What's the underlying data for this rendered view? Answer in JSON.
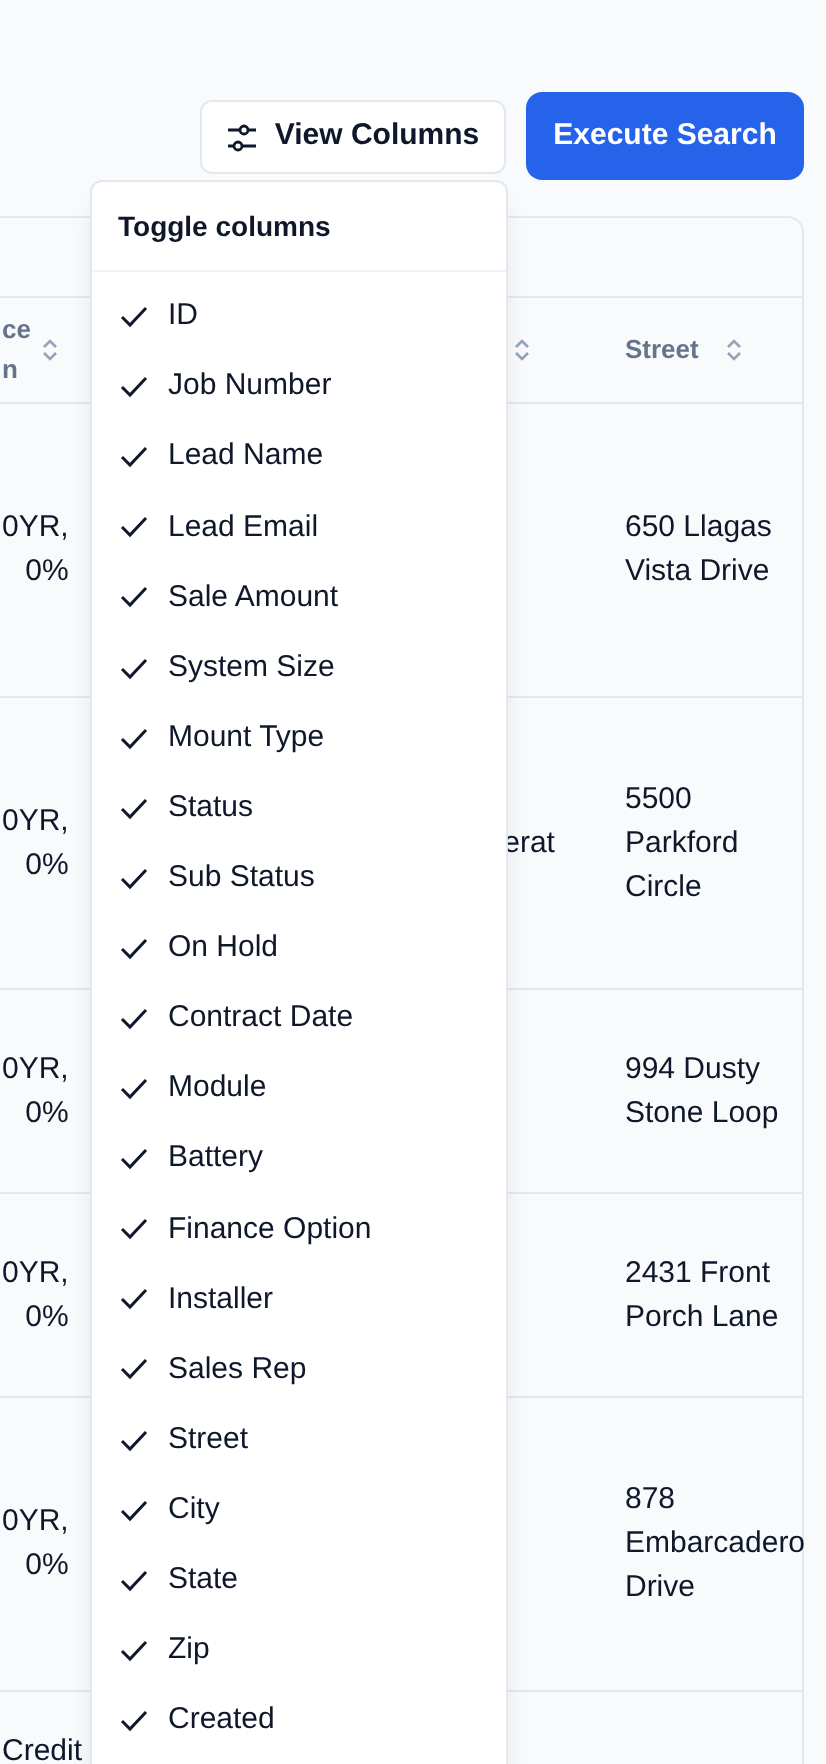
{
  "toolbar": {
    "view_columns": "View Columns",
    "execute": "Execute Search"
  },
  "table": {
    "columns": [
      {
        "label": "ce n",
        "sortable": true
      },
      {
        "sortable": true
      },
      {
        "label": "Street",
        "sortable": true
      }
    ],
    "rows": [
      {
        "cells": [
          [
            "0YR,",
            "0%"
          ],
          [],
          [
            "650 Llagas Vista Drive"
          ]
        ]
      },
      {
        "cells": [
          [
            "0YR,",
            "0%"
          ],
          [
            "erat"
          ],
          [
            "5500 Parkford Circle"
          ]
        ]
      },
      {
        "cells": [
          [
            "0YR,",
            "0%"
          ],
          [],
          [
            "994 Dusty Stone Loop"
          ]
        ]
      },
      {
        "cells": [
          [
            "0YR,",
            "0%"
          ],
          [],
          [
            "2431 Front Porch Lane"
          ]
        ]
      },
      {
        "cells": [
          [
            "0YR,",
            "0%"
          ],
          [],
          [
            "878 Embarcadero Drive"
          ]
        ]
      },
      {
        "cells": [
          [
            "Credit"
          ],
          [],
          []
        ]
      }
    ]
  },
  "column_menu": {
    "title": "Toggle columns",
    "items": [
      {
        "label": "ID",
        "checked": true
      },
      {
        "label": "Job Number",
        "checked": true
      },
      {
        "label": "Lead Name",
        "checked": true
      },
      {
        "label": "Lead Email",
        "checked": true
      },
      {
        "label": "Sale Amount",
        "checked": true
      },
      {
        "label": "System Size",
        "checked": true
      },
      {
        "label": "Mount Type",
        "checked": true
      },
      {
        "label": "Status",
        "checked": true
      },
      {
        "label": "Sub Status",
        "checked": true
      },
      {
        "label": "On Hold",
        "checked": true
      },
      {
        "label": "Contract Date",
        "checked": true
      },
      {
        "label": "Module",
        "checked": true
      },
      {
        "label": "Battery",
        "checked": true
      },
      {
        "label": "Finance Option",
        "checked": true
      },
      {
        "label": "Installer",
        "checked": true
      },
      {
        "label": "Sales Rep",
        "checked": true
      },
      {
        "label": "Street",
        "checked": true
      },
      {
        "label": "City",
        "checked": true
      },
      {
        "label": "State",
        "checked": true
      },
      {
        "label": "Zip",
        "checked": true
      },
      {
        "label": "Created",
        "checked": true
      }
    ]
  }
}
